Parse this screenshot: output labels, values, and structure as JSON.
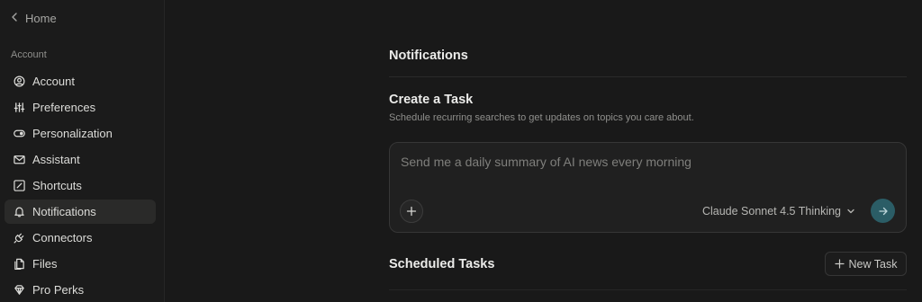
{
  "sidebar": {
    "home_label": "Home",
    "section_label": "Account",
    "items": [
      {
        "label": "Account",
        "icon": "user-circle-icon"
      },
      {
        "label": "Preferences",
        "icon": "sliders-icon"
      },
      {
        "label": "Personalization",
        "icon": "toggle-icon"
      },
      {
        "label": "Assistant",
        "icon": "mail-icon"
      },
      {
        "label": "Shortcuts",
        "icon": "shortcut-icon"
      },
      {
        "label": "Notifications",
        "icon": "bell-icon",
        "active": true
      },
      {
        "label": "Connectors",
        "icon": "plug-icon"
      },
      {
        "label": "Files",
        "icon": "files-icon"
      },
      {
        "label": "Pro Perks",
        "icon": "perks-icon"
      }
    ]
  },
  "main": {
    "page_title": "Notifications",
    "create_task": {
      "title": "Create a Task",
      "subtitle": "Schedule recurring searches to get updates on topics you care about.",
      "placeholder": "Send me a daily summary of AI news every morning",
      "model": "Claude Sonnet 4.5 Thinking"
    },
    "scheduled": {
      "title": "Scheduled Tasks",
      "new_task_label": "New Task"
    }
  },
  "colors": {
    "background": "#191919",
    "sidebar_bg": "#1b1b1b",
    "active_item_bg": "#2a2a29",
    "send_button": "#2b5d66"
  }
}
